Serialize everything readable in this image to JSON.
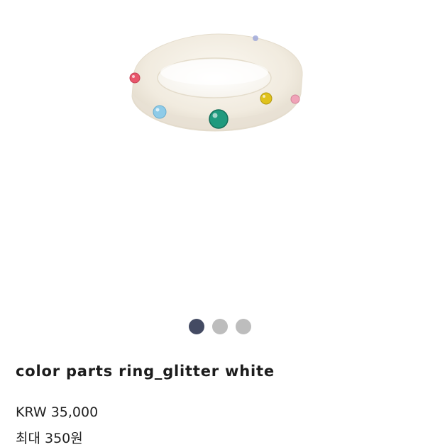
{
  "product": {
    "title": "color parts ring_glitter white",
    "price": "KRW 35,000",
    "points": "최대 350원"
  },
  "gallery": {
    "image_name": "ring-product-image",
    "slides_total": 3,
    "active_slide": 1,
    "dot_colors": {
      "active": "#444b63",
      "inactive": "#bdbdbd"
    },
    "gem_colors": [
      "#e8566b",
      "#8ecbe8",
      "#1f9a7e",
      "#e0c21c",
      "#f0a3b8",
      "#9aa4d8"
    ]
  }
}
